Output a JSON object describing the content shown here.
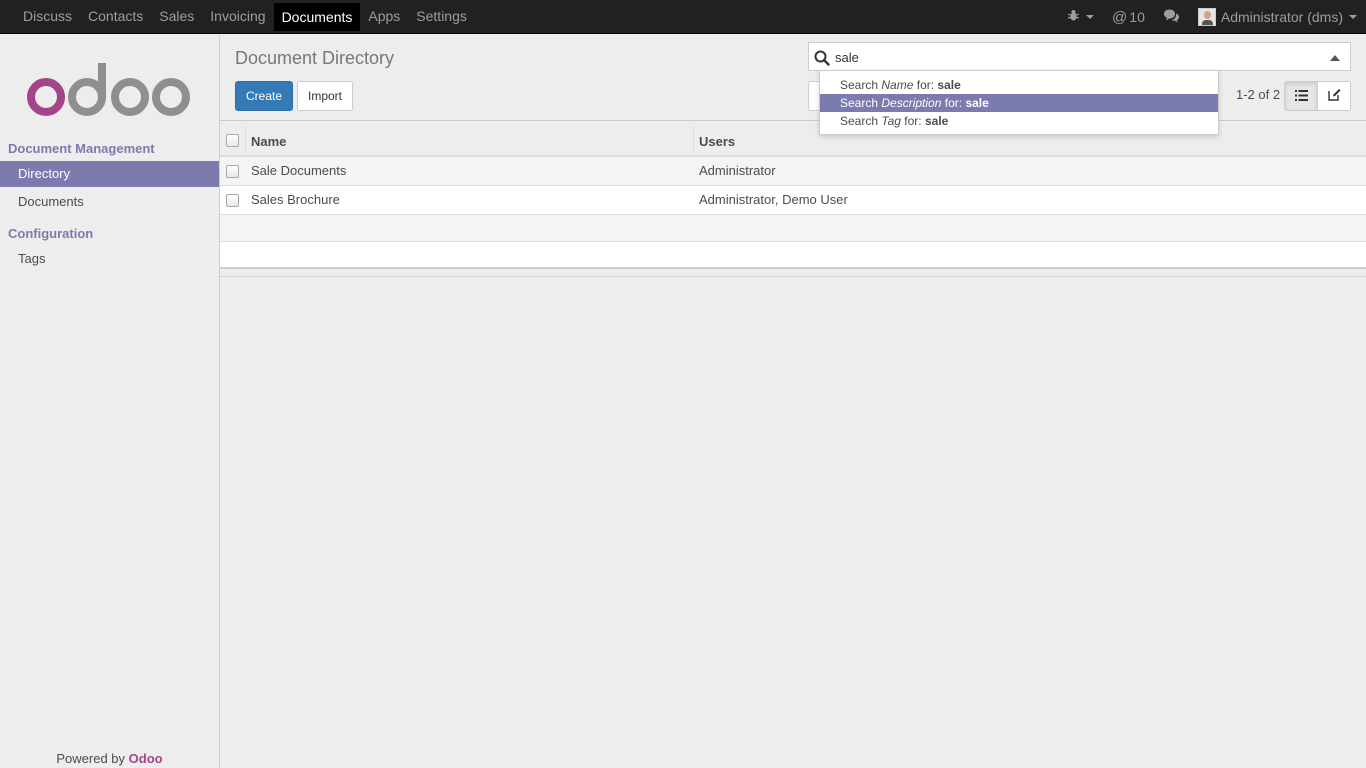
{
  "topbar": {
    "apps": [
      "Discuss",
      "Contacts",
      "Sales",
      "Invoicing",
      "Documents",
      "Apps",
      "Settings"
    ],
    "active_app": "Documents",
    "messages_count": "10",
    "user_label": "Administrator (dms)"
  },
  "sidebar": {
    "section1": "Document Management",
    "items1": [
      "Directory",
      "Documents"
    ],
    "section2": "Configuration",
    "items2": [
      "Tags"
    ],
    "powered_prefix": "Powered by",
    "powered_brand": "Odoo"
  },
  "control_panel": {
    "title": "Document Directory",
    "create_label": "Create",
    "import_label": "Import",
    "search_value": "sale",
    "pager": "1-2 of 2"
  },
  "autocomplete": [
    {
      "prefix": "Search",
      "field": "Name",
      "mid": "for:",
      "term": "sale"
    },
    {
      "prefix": "Search",
      "field": "Description",
      "mid": "for:",
      "term": "sale"
    },
    {
      "prefix": "Search",
      "field": "Tag",
      "mid": "for:",
      "term": "sale"
    }
  ],
  "list": {
    "columns": [
      "Name",
      "Users"
    ],
    "rows": [
      {
        "name": "Sale Documents",
        "users": "Administrator"
      },
      {
        "name": "Sales Brochure",
        "users": "Administrator, Demo User"
      }
    ]
  },
  "colors": {
    "brand_purple": "#7c7bad",
    "odoo_magenta": "#a24689",
    "primary_blue": "#337ab7"
  },
  "icons": {
    "debug": "bug-icon",
    "messages": "at-icon",
    "chat": "comments-icon",
    "search": "search-icon",
    "list_view": "list-icon",
    "form_view": "edit-icon"
  }
}
